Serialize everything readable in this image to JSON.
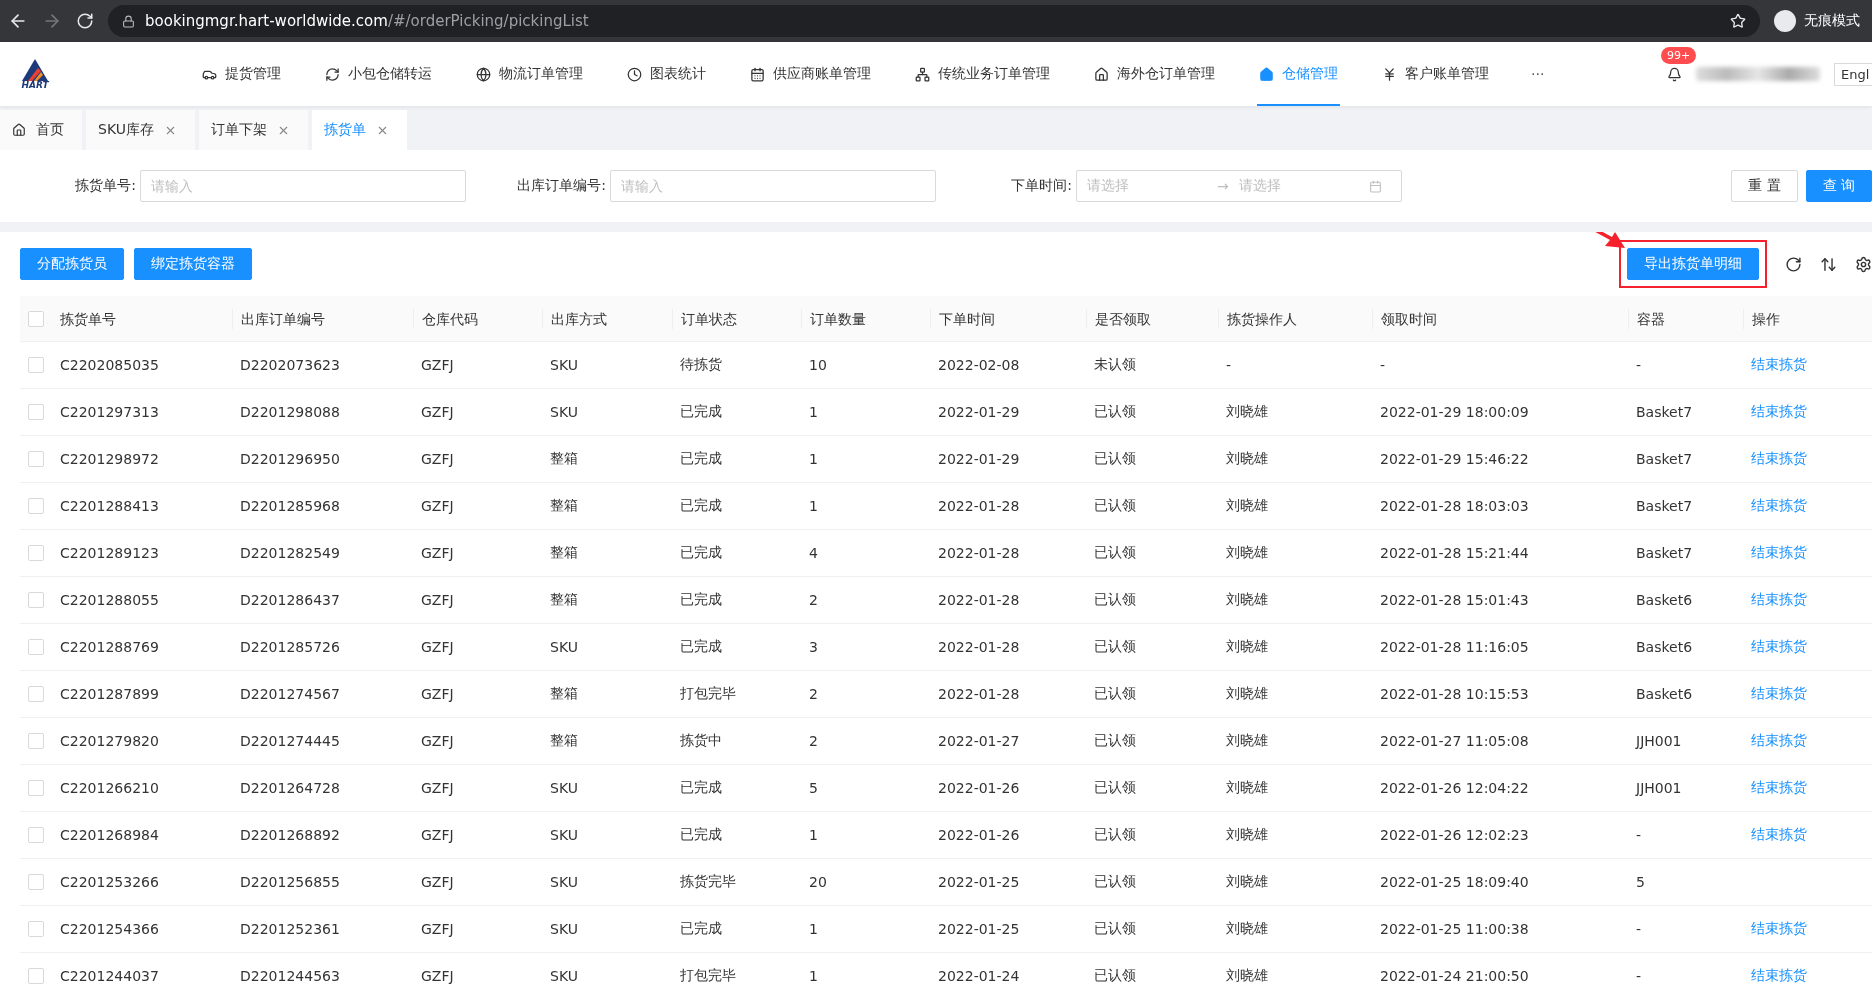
{
  "browser": {
    "url_host": "bookingmgr.hart-worldwide.com",
    "url_path": "/#/orderPicking/pickingList",
    "profile_label": "无痕模式"
  },
  "header": {
    "logo_text": "HART",
    "items": [
      {
        "label": "提货管理",
        "selected": false
      },
      {
        "label": "小包仓储转运",
        "selected": false
      },
      {
        "label": "物流订单管理",
        "selected": false
      },
      {
        "label": "图表统计",
        "selected": false
      },
      {
        "label": "供应商账单管理",
        "selected": false
      },
      {
        "label": "传统业务订单管理",
        "selected": false
      },
      {
        "label": "海外仓订单管理",
        "selected": false
      },
      {
        "label": "仓储管理",
        "selected": true
      },
      {
        "label": "客户账单管理",
        "selected": false
      }
    ],
    "more": "···",
    "badge": "99+",
    "language": "Engl"
  },
  "tabs": [
    {
      "kind": "home",
      "label": "首页",
      "selected": false
    },
    {
      "kind": "page",
      "label": "SKU库存",
      "selected": false
    },
    {
      "kind": "page",
      "label": "订单下架",
      "selected": false
    },
    {
      "kind": "page",
      "label": "拣货单",
      "selected": true
    }
  ],
  "filters": {
    "fields": [
      {
        "label": "拣货单号:",
        "placeholder": "请输入"
      },
      {
        "label": "出库订单编号:",
        "placeholder": "请输入"
      }
    ],
    "date_range": {
      "label": "下单时间:",
      "start_placeholder": "请选择",
      "separator": "→",
      "end_placeholder": "请选择"
    },
    "reset": "重 置",
    "search": "查 询"
  },
  "toolbar": {
    "actions": [
      "分配拣货员",
      "绑定拣货容器"
    ],
    "export": {
      "label": "导出拣货单明细",
      "highlighted": true
    }
  },
  "table": {
    "all_selected": false,
    "columns": [
      "拣货单号",
      "出库订单编号",
      "仓库代码",
      "出库方式",
      "订单状态",
      "订单数量",
      "下单时间",
      "是否领取",
      "拣货操作人",
      "领取时间",
      "容器",
      "操作"
    ],
    "rows": [
      {
        "selected": false,
        "cells": [
          "C2202085035",
          "D2202073623",
          "GZFJ",
          "SKU",
          "待拣货",
          "10",
          "2022-02-08",
          "未认领",
          "-",
          "-",
          "-"
        ],
        "action": "结束拣货"
      },
      {
        "selected": false,
        "cells": [
          "C2201297313",
          "D2201298088",
          "GZFJ",
          "SKU",
          "已完成",
          "1",
          "2022-01-29",
          "已认领",
          "刘晓雄",
          "2022-01-29 18:00:09",
          "Basket7"
        ],
        "action": "结束拣货"
      },
      {
        "selected": false,
        "cells": [
          "C2201298972",
          "D2201296950",
          "GZFJ",
          "整箱",
          "已完成",
          "1",
          "2022-01-29",
          "已认领",
          "刘晓雄",
          "2022-01-29 15:46:22",
          "Basket7"
        ],
        "action": "结束拣货"
      },
      {
        "selected": false,
        "cells": [
          "C2201288413",
          "D2201285968",
          "GZFJ",
          "整箱",
          "已完成",
          "1",
          "2022-01-28",
          "已认领",
          "刘晓雄",
          "2022-01-28 18:03:03",
          "Basket7"
        ],
        "action": "结束拣货"
      },
      {
        "selected": false,
        "cells": [
          "C2201289123",
          "D2201282549",
          "GZFJ",
          "整箱",
          "已完成",
          "4",
          "2022-01-28",
          "已认领",
          "刘晓雄",
          "2022-01-28 15:21:44",
          "Basket7"
        ],
        "action": "结束拣货"
      },
      {
        "selected": false,
        "cells": [
          "C2201288055",
          "D2201286437",
          "GZFJ",
          "整箱",
          "已完成",
          "2",
          "2022-01-28",
          "已认领",
          "刘晓雄",
          "2022-01-28 15:01:43",
          "Basket6"
        ],
        "action": "结束拣货"
      },
      {
        "selected": false,
        "cells": [
          "C2201288769",
          "D2201285726",
          "GZFJ",
          "SKU",
          "已完成",
          "3",
          "2022-01-28",
          "已认领",
          "刘晓雄",
          "2022-01-28 11:16:05",
          "Basket6"
        ],
        "action": "结束拣货"
      },
      {
        "selected": false,
        "cells": [
          "C2201287899",
          "D2201274567",
          "GZFJ",
          "整箱",
          "打包完毕",
          "2",
          "2022-01-28",
          "已认领",
          "刘晓雄",
          "2022-01-28 10:15:53",
          "Basket6"
        ],
        "action": "结束拣货"
      },
      {
        "selected": false,
        "cells": [
          "C2201279820",
          "D2201274445",
          "GZFJ",
          "整箱",
          "拣货中",
          "2",
          "2022-01-27",
          "已认领",
          "刘晓雄",
          "2022-01-27 11:05:08",
          "JJH001"
        ],
        "action": "结束拣货"
      },
      {
        "selected": false,
        "cells": [
          "C2201266210",
          "D2201264728",
          "GZFJ",
          "SKU",
          "已完成",
          "5",
          "2022-01-26",
          "已认领",
          "刘晓雄",
          "2022-01-26 12:04:22",
          "JJH001"
        ],
        "action": "结束拣货"
      },
      {
        "selected": false,
        "cells": [
          "C2201268984",
          "D2201268892",
          "GZFJ",
          "SKU",
          "已完成",
          "1",
          "2022-01-26",
          "已认领",
          "刘晓雄",
          "2022-01-26 12:02:23",
          "-"
        ],
        "action": "结束拣货"
      },
      {
        "selected": false,
        "cells": [
          "C2201253266",
          "D2201256855",
          "GZFJ",
          "SKU",
          "拣货完毕",
          "20",
          "2022-01-25",
          "已认领",
          "刘晓雄",
          "2022-01-25 18:09:40",
          "5"
        ]
      },
      {
        "selected": false,
        "cells": [
          "C2201254366",
          "D2201252361",
          "GZFJ",
          "SKU",
          "已完成",
          "1",
          "2022-01-25",
          "已认领",
          "刘晓雄",
          "2022-01-25 11:00:38",
          "-"
        ],
        "action": "结束拣货"
      },
      {
        "selected": false,
        "cells": [
          "C2201244037",
          "D2201244563",
          "GZFJ",
          "SKU",
          "打包完毕",
          "1",
          "2022-01-24",
          "已认领",
          "刘晓雄",
          "2022-01-24 21:00:50",
          "-"
        ],
        "action": "结束拣货"
      }
    ]
  }
}
